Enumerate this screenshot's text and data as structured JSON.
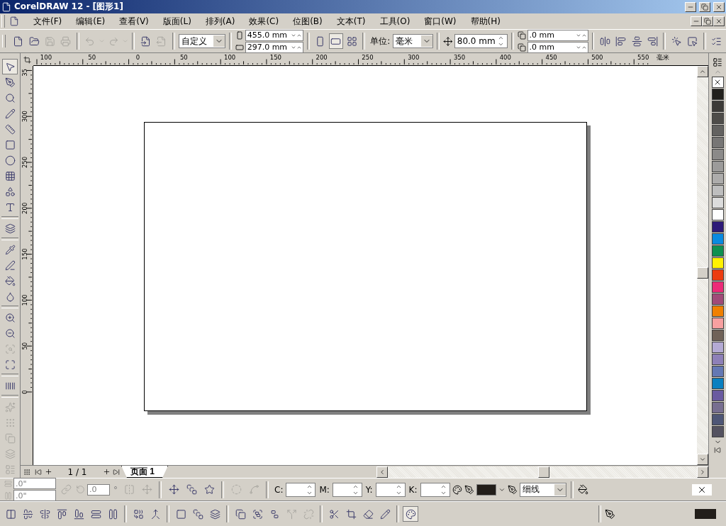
{
  "window": {
    "title": "CorelDRAW 12 - [图形1]"
  },
  "menu": [
    "文件(F)",
    "编辑(E)",
    "查看(V)",
    "版面(L)",
    "排列(A)",
    "效果(C)",
    "位图(B)",
    "文本(T)",
    "工具(O)",
    "窗口(W)",
    "帮助(H)"
  ],
  "toolbar": {
    "file_buttons": [
      {
        "disabled": false
      },
      {
        "disabled": false
      },
      {
        "disabled": true
      },
      {
        "disabled": true
      }
    ],
    "history_buttons": [
      {
        "disabled": true
      },
      {
        "disabled": true
      }
    ],
    "transfer_buttons": [
      {
        "disabled": false
      },
      {
        "disabled": true
      }
    ],
    "page_preset": "自定义",
    "page_width": "455.0 mm",
    "page_height": "297.0 mm",
    "orientation": [
      {
        "selected": false
      },
      {
        "selected": true
      }
    ],
    "units_label": "单位:",
    "units": "毫米",
    "nudge": "80.0 mm",
    "duplicate_x": ".0 mm",
    "duplicate_y": ".0 mm"
  },
  "rulers": {
    "horizontal": [
      "100",
      "50",
      "0",
      "50",
      "100",
      "150",
      "200",
      "250",
      "300",
      "350",
      "400",
      "450",
      "500",
      "550"
    ],
    "horizontal_unit": "毫米",
    "vertical": [
      "35",
      "300",
      "250",
      "200",
      "150",
      "100",
      "50",
      "0"
    ]
  },
  "toolbox": [
    [
      {
        "selected": true,
        "disabled": false
      },
      {
        "selected": false,
        "disabled": false
      },
      {
        "selected": false,
        "disabled": false
      },
      {
        "selected": false,
        "disabled": false
      },
      {
        "selected": false,
        "disabled": false
      },
      {
        "selected": false,
        "disabled": false
      },
      {
        "selected": false,
        "disabled": false
      },
      {
        "selected": false,
        "disabled": false
      },
      {
        "selected": false,
        "disabled": false
      },
      {
        "selected": false,
        "disabled": false
      }
    ],
    [
      {
        "selected": false,
        "disabled": false
      }
    ],
    [
      {
        "selected": false,
        "disabled": false
      },
      {
        "selected": false,
        "disabled": false
      },
      {
        "selected": false,
        "disabled": false
      },
      {
        "selected": false,
        "disabled": false
      }
    ],
    [
      {
        "selected": false,
        "disabled": false
      },
      {
        "selected": false,
        "disabled": false
      },
      {
        "selected": false,
        "disabled": true
      },
      {
        "selected": false,
        "disabled": false
      }
    ],
    [
      {
        "selected": false,
        "disabled": false
      }
    ],
    [
      {
        "selected": false,
        "disabled": true
      },
      {
        "selected": false,
        "disabled": true
      },
      {
        "selected": false,
        "disabled": true
      },
      {
        "selected": false,
        "disabled": true
      },
      {
        "selected": false,
        "disabled": true
      }
    ]
  ],
  "page_nav": {
    "counter": "1 / 1",
    "tabs": [
      {
        "label": "页面 1",
        "selected": true
      }
    ]
  },
  "palette": [
    {
      "color": "#22201c"
    },
    {
      "color": "#3c3a37"
    },
    {
      "color": "#4e4c49"
    },
    {
      "color": "#636260"
    },
    {
      "color": "#777675"
    },
    {
      "color": "#8b8a89"
    },
    {
      "color": "#9c9b9a"
    },
    {
      "color": "#adacab"
    },
    {
      "color": "#bebebe"
    },
    {
      "color": "#dcdcdc"
    },
    {
      "color": "#ffffff"
    },
    {
      "color": "#2e1a78"
    },
    {
      "color": "#0a8ae0"
    },
    {
      "color": "#0f9050"
    },
    {
      "color": "#fff200"
    },
    {
      "color": "#ec3c10"
    },
    {
      "color": "#ec2a78"
    },
    {
      "color": "#a04a78"
    },
    {
      "color": "#f08000"
    },
    {
      "color": "#f8a0a0"
    },
    {
      "color": "#706258"
    },
    {
      "color": "#b4aad4"
    },
    {
      "color": "#8e80b8"
    },
    {
      "color": "#6478b4"
    },
    {
      "color": "#0a80c0"
    },
    {
      "color": "#6a5aa0"
    },
    {
      "color": "#776e90"
    },
    {
      "color": "#4e5676"
    },
    {
      "color": "#545260"
    }
  ],
  "property_bar": {
    "pos_x": ".0\"",
    "pos_y": ".0\"",
    "rotation": ".0",
    "degree": "°",
    "cmyk": [
      "C:",
      "M:",
      "Y:",
      "K:"
    ],
    "outline_width": "细线"
  }
}
